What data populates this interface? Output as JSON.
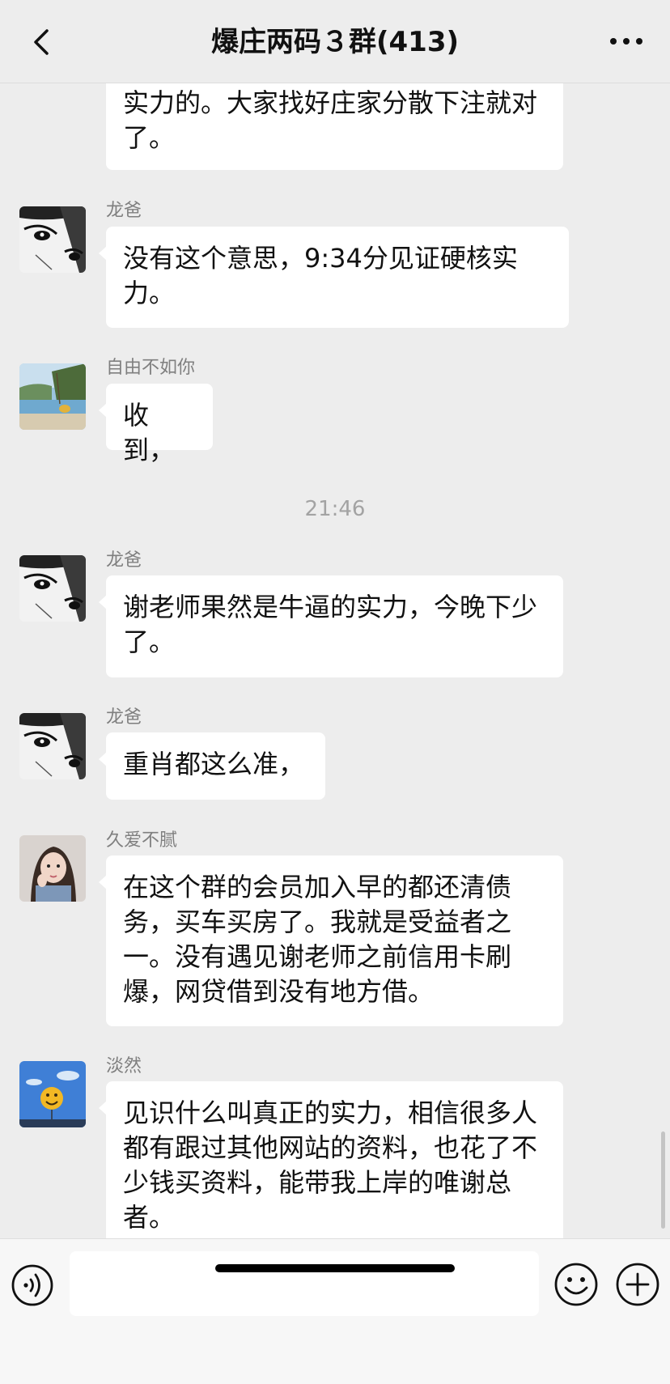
{
  "header": {
    "title": "爆庄两码３群(413)",
    "back_icon": "chevron-left-icon",
    "more_icon": "ellipsis-icon"
  },
  "messages": [
    {
      "sender": "",
      "text": "实力的。大家找好庄家分散下注就对了。",
      "avatar": ""
    },
    {
      "sender": "龙爸",
      "text": "没有这个意思，9:34分见证硬核实力。",
      "avatar": "manga-eyes-avatar"
    },
    {
      "sender": "自由不如你",
      "text": "收到，",
      "avatar": "lake-avatar"
    },
    {
      "sender": "龙爸",
      "text": "谢老师果然是牛逼的实力，今晚下少了。",
      "avatar": "manga-eyes-avatar"
    },
    {
      "sender": "龙爸",
      "text": "重肖都这么准，",
      "avatar": "manga-eyes-avatar"
    },
    {
      "sender": "久爱不腻",
      "text": "在这个群的会员加入早的都还清债务，买车买房了。我就是受益者之一。没有遇见谢老师之前信用卡刷爆，网贷借到没有地方借。",
      "avatar": "girl-avatar"
    },
    {
      "sender": "淡然",
      "text": "见识什么叫真正的实力，相信很多人都有跟过其他网站的资料，也花了不少钱买资料，能带我上岸的唯谢总者。",
      "avatar": "smiley-balloon-avatar"
    }
  ],
  "timestamp": "21:46",
  "input_bar": {
    "placeholder": "",
    "voice_icon": "voice-icon",
    "emoji_icon": "emoji-icon",
    "plus_icon": "plus-icon"
  },
  "colors": {
    "background": "#ededed",
    "bubble": "#ffffff",
    "sender_name": "#7f7f7f",
    "timestamp": "#a3a3a3"
  }
}
